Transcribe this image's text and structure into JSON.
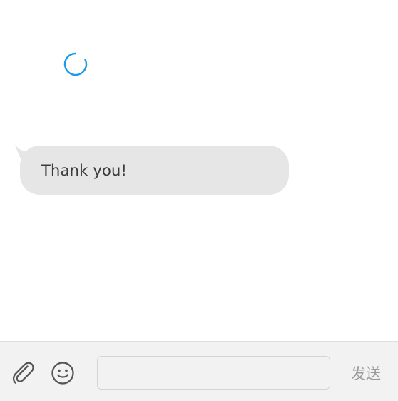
{
  "chat": {
    "loading": true,
    "messages": [
      {
        "text": "Thank you!",
        "direction": "incoming"
      }
    ]
  },
  "composer": {
    "input_value": "",
    "input_placeholder": "",
    "send_label": "发送"
  },
  "icons": {
    "attach": "paperclip-icon",
    "emoji": "smiley-icon",
    "loading": "spinner-icon"
  },
  "colors": {
    "spinner": "#1a9bea",
    "bubble": "#e6e6e6",
    "bar_background": "#f2f2f2",
    "send_text": "#9a9a9a"
  }
}
